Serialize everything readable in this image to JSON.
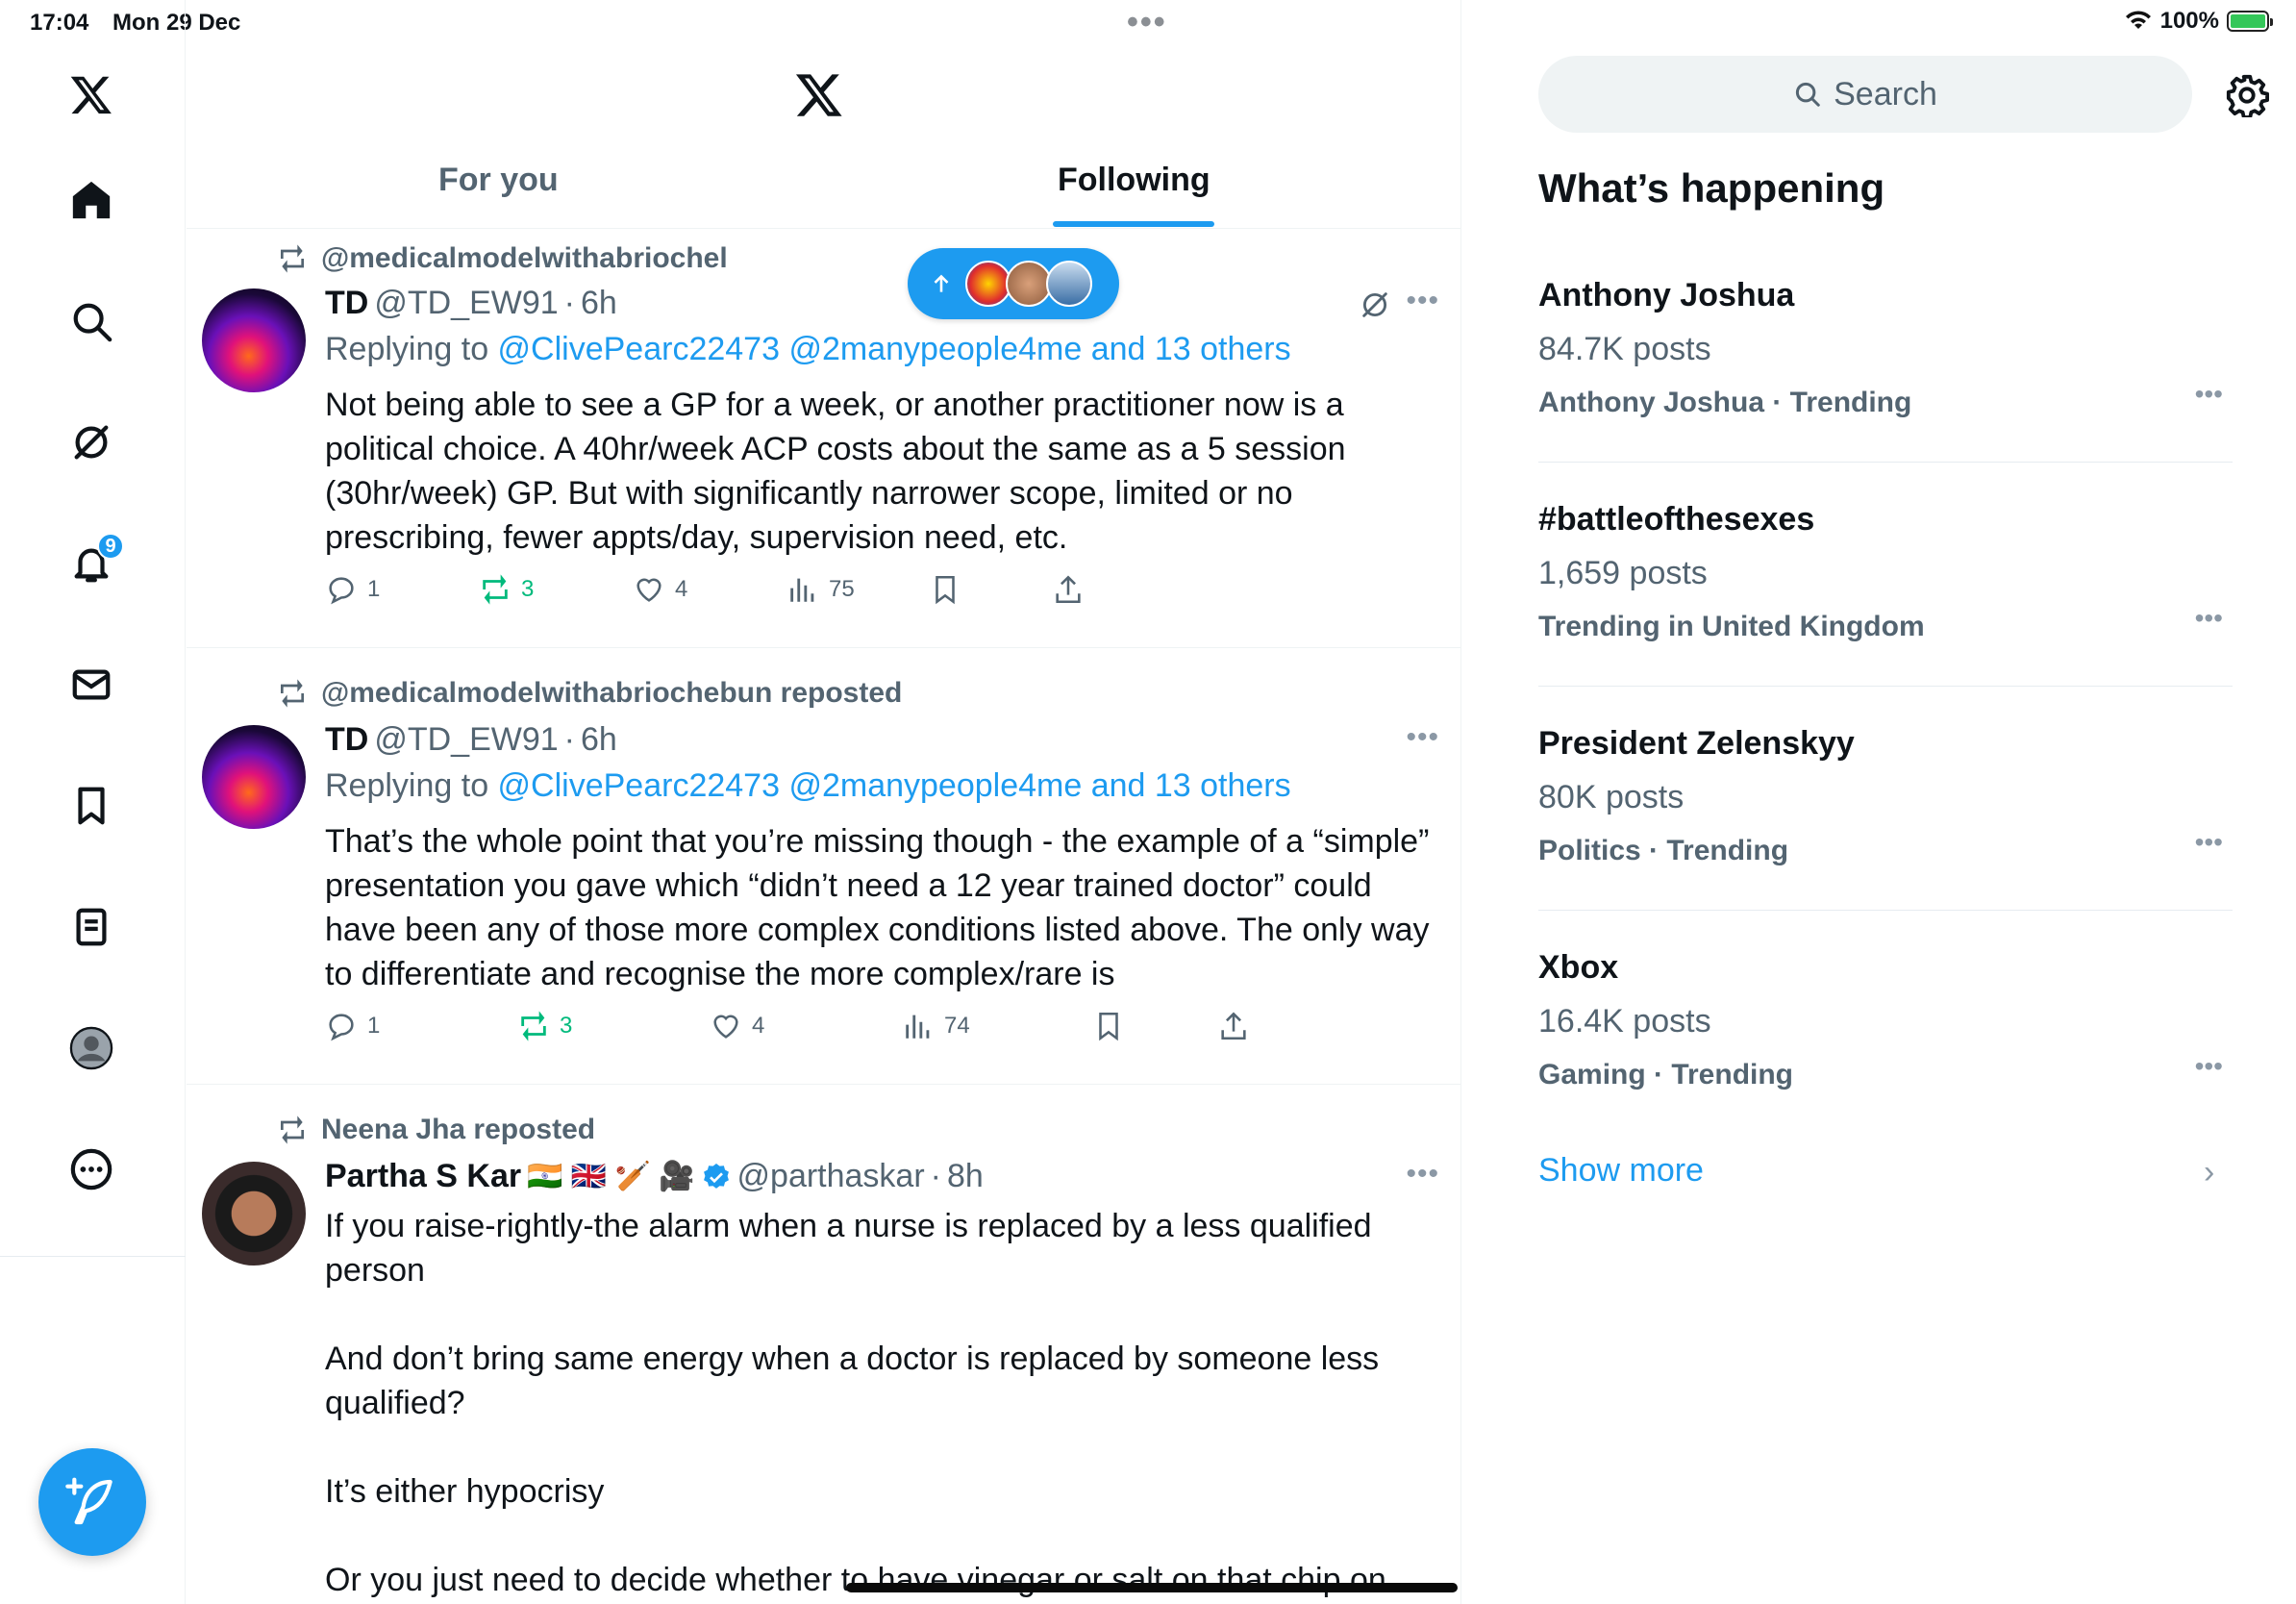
{
  "status": {
    "time": "17:04",
    "date": "Mon 29 Dec",
    "battery": "100%"
  },
  "nav": {
    "notifications_badge": "9"
  },
  "tabs": {
    "for_you": "For you",
    "following": "Following"
  },
  "posts": [
    {
      "repost_by": "@medicalmodelwithabriochel",
      "name": "TD",
      "handle": "@TD_EW91",
      "time": "6h",
      "replying_prefix": "Replying to ",
      "reply_to": "@ClivePearc22473 @2manypeople4me and 13 others",
      "text": "Not being able to see a GP for a week, or another practitioner now is a political choice. A 40hr/week ACP costs about the same as a 5 session (30hr/week) GP. But with significantly narrower scope, limited or no prescribing, fewer appts/day, supervision need, etc.",
      "replies": "1",
      "reposts": "3",
      "likes": "4",
      "views": "75"
    },
    {
      "repost_by": "@medicalmodelwithabriochebun reposted",
      "name": "TD",
      "handle": "@TD_EW91",
      "time": "6h",
      "replying_prefix": "Replying to ",
      "reply_to": "@ClivePearc22473 @2manypeople4me and 13 others",
      "text": "That’s the whole point that you’re missing though - the example of a “simple” presentation you gave which “didn’t need a 12 year trained doctor” could have been any of those more complex conditions listed above. The only way to differentiate and recognise the more complex/rare is",
      "replies": "1",
      "reposts": "3",
      "likes": "4",
      "views": "74"
    },
    {
      "repost_by": "Neena Jha reposted",
      "name": "Partha S Kar",
      "emojis": "🇮🇳 🇬🇧 🏏 🎥",
      "handle": "@parthaskar",
      "time": "8h",
      "paragraphs": [
        "If you raise-rightly-the alarm when a nurse is replaced by a less qualified person",
        "And don’t bring same energy when a doctor is replaced by someone less qualified?",
        "It’s either hypocrisy",
        "Or you just need to decide whether to have vinegar or salt on that chip on"
      ]
    }
  ],
  "sidebar": {
    "search_placeholder": "Search",
    "heading": "What’s happening",
    "trends": [
      {
        "title": "Anthony Joshua",
        "count": "84.7K posts",
        "meta": "Anthony Joshua · Trending"
      },
      {
        "title": "#battleofthesexes",
        "count": "1,659 posts",
        "meta": "Trending in United Kingdom"
      },
      {
        "title": "President Zelenskyy",
        "count": "80K posts",
        "meta": "Politics · Trending"
      },
      {
        "title": "Xbox",
        "count": "16.4K posts",
        "meta": "Gaming · Trending"
      }
    ],
    "show_more": "Show more"
  },
  "colors": {
    "accent": "#1d9bf0",
    "repost_green": "#00ba7c",
    "secondary_text": "#536471"
  }
}
